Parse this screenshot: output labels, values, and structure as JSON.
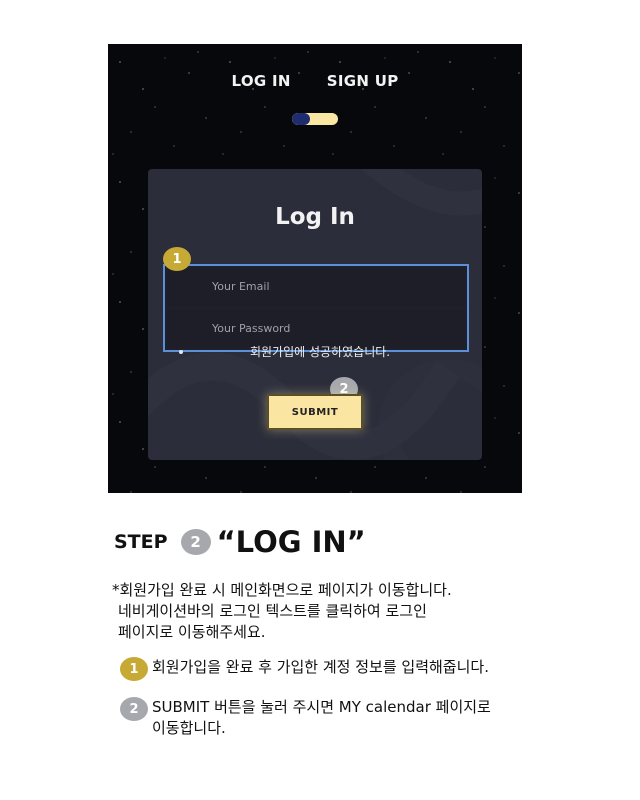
{
  "screenshot": {
    "nav": {
      "login": "LOG IN",
      "signup": "SIGN UP"
    },
    "card": {
      "title": "Log In",
      "email_placeholder": "Your Email",
      "password_placeholder": "Your Password",
      "success_message": "회원가입에 성공하였습니다.",
      "submit_label": "SUBMIT"
    },
    "markers": {
      "one": "1",
      "two": "2"
    }
  },
  "step": {
    "label": "STEP",
    "number": "2",
    "title": "“LOG IN”"
  },
  "note": {
    "line1": "*회원가입 완료 시 메인화면으로 페이지가 이동합니다.",
    "line2": "네비게이션바의 로그인 텍스트를 클릭하여 로그인",
    "line3": "페이지로 이동해주세요."
  },
  "items": [
    {
      "num": "1",
      "text": "회원가입을 완료 후 가입한 계정 정보를 입력해줍니다."
    },
    {
      "num": "2",
      "text_line1": "SUBMIT 버튼을 눌러 주시면 MY calendar 페이지로",
      "text_line2": "이동합니다."
    }
  ],
  "colors": {
    "gold": "#c7a935",
    "gray": "#a6a8ad",
    "submit_bg": "#fbe5a2",
    "accent_border": "#5b8fd8"
  }
}
